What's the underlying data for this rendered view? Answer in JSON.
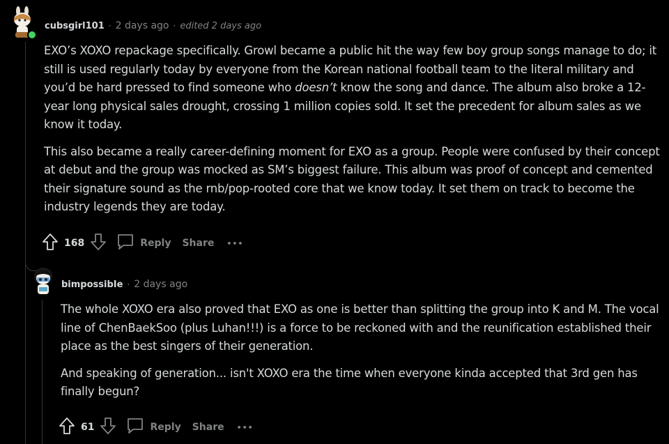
{
  "comments": [
    {
      "author": "cubsgirl101",
      "separator": "·",
      "time": "2 days ago",
      "edited": "edited 2 days ago",
      "paragraphs": [
        {
          "before": "EXO’s XOXO repackage specifically. Growl became a public hit the way few boy group songs manage to do; it still is used regularly today by everyone from the Korean national football team to the literal military and you’d be hard pressed to find someone who ",
          "em": "doesn’t",
          "after": " know the song and dance. The album also broke a 12-year long physical sales drought, crossing 1 million copies sold. It set the precedent for album sales as we know it today."
        },
        {
          "before": "This also became a really career-defining moment for EXO as a group. People were confused by their concept at debut and the group was mocked as SM’s biggest failure. This album was proof of concept and cemented their signature sound as the rnb/pop-rooted core that we know today. It set them on track to become the industry legends they are today.",
          "em": "",
          "after": ""
        }
      ],
      "score": "168",
      "reply_label": "Reply",
      "share_label": "Share",
      "more_label": "•••",
      "online_color": "#46d160"
    },
    {
      "author": "bimpossibIe",
      "separator": "·",
      "time": "2 days ago",
      "edited": "",
      "paragraphs": [
        {
          "before": "The whole XOXO era also proved that EXO as one is better than splitting the group into K and M. The vocal line of ChenBaekSoo (plus Luhan!!!) is a force to be reckoned with and the reunification established their place as the best singers of their generation.",
          "em": "",
          "after": ""
        },
        {
          "before": "And speaking of generation... isn't XOXO era the time when everyone kinda accepted that 3rd gen has finally begun?",
          "em": "",
          "after": ""
        }
      ],
      "score": "61",
      "reply_label": "Reply",
      "share_label": "Share",
      "more_label": "•••"
    }
  ],
  "icons": {
    "upvote": "upvote-arrow-icon",
    "downvote": "downvote-arrow-icon",
    "reply": "speech-bubble-icon",
    "more": "ellipsis-icon"
  },
  "colors": {
    "background": "#000000",
    "text": "#d7dadc",
    "muted": "#818384",
    "thread_line": "#343536"
  }
}
